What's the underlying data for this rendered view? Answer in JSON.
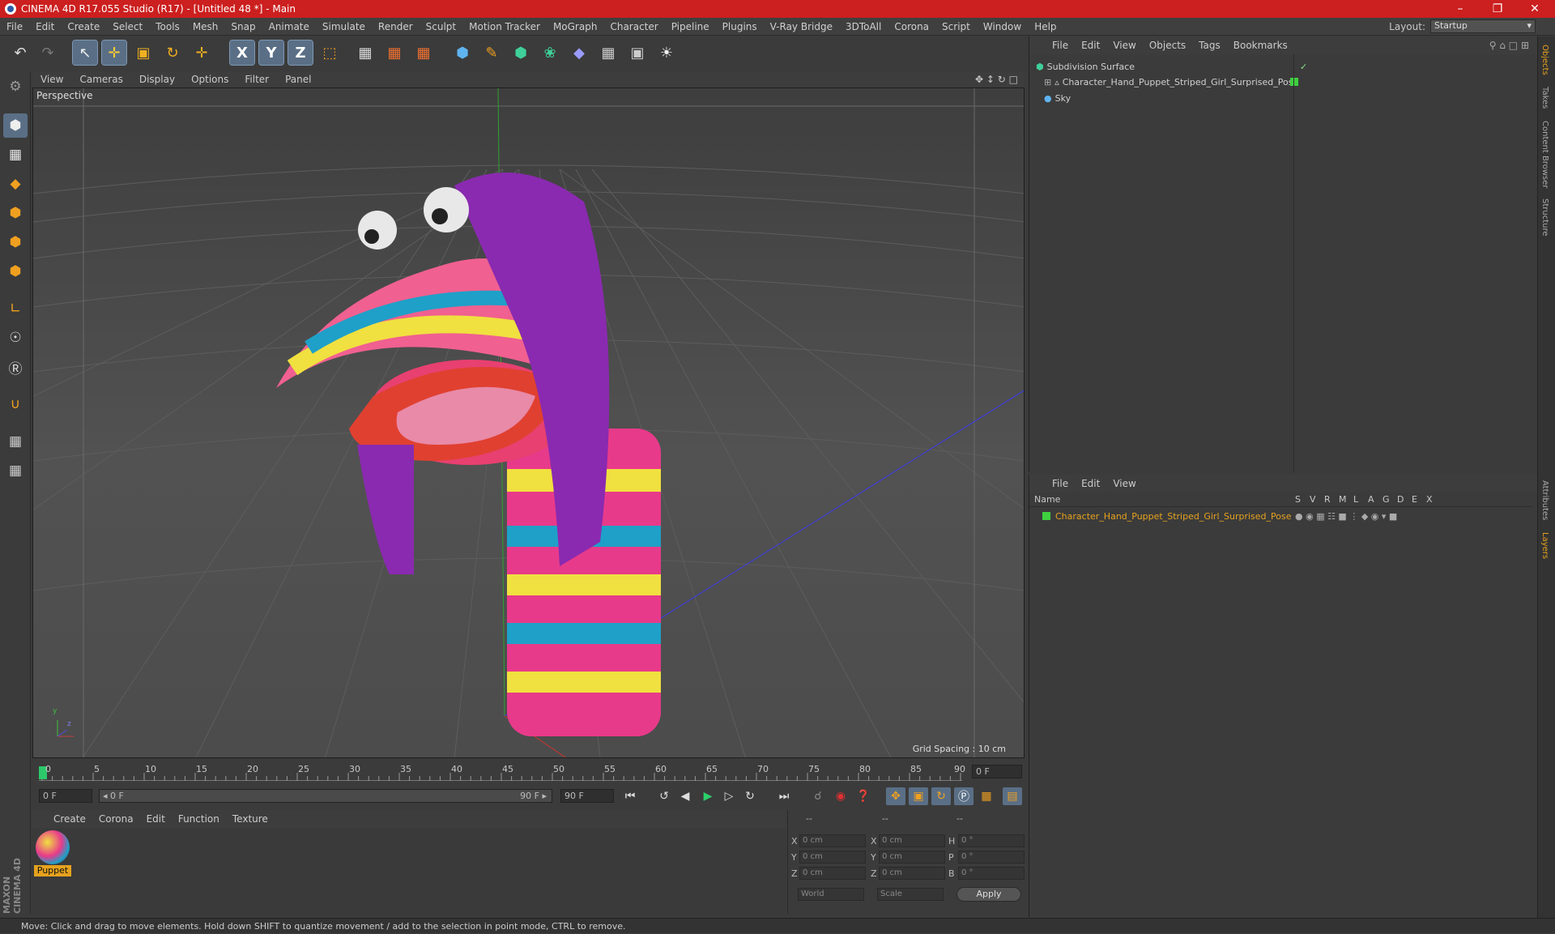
{
  "window": {
    "title": "CINEMA 4D R17.055 Studio (R17) - [Untitled 48 *] - Main",
    "controls": [
      "–",
      "❐",
      "✕"
    ]
  },
  "menubar": [
    "File",
    "Edit",
    "Create",
    "Select",
    "Tools",
    "Mesh",
    "Snap",
    "Animate",
    "Simulate",
    "Render",
    "Sculpt",
    "Motion Tracker",
    "MoGraph",
    "Character",
    "Pipeline",
    "Plugins",
    "V-Ray Bridge",
    "3DToAll",
    "Corona",
    "Script",
    "Window",
    "Help"
  ],
  "layout": {
    "label": "Layout:",
    "value": "Startup"
  },
  "toolbar": {
    "undo": "↶",
    "redo": "↷",
    "select": "↖",
    "move": "✛",
    "scale": "▣",
    "rotate": "↻",
    "transform": "✛",
    "x": "X",
    "y": "Y",
    "z": "Z",
    "coord": "⬚",
    "render1": "▦",
    "render2": "▦",
    "render3": "▦",
    "cube": "⬢",
    "pen": "✎",
    "subdiv": "⬢",
    "array": "❀",
    "deformer": "◆",
    "floor": "▦",
    "camera": "▣",
    "light": "☀"
  },
  "viewport": {
    "menu": [
      "View",
      "Cameras",
      "Display",
      "Options",
      "Filter",
      "Panel"
    ],
    "label": "Perspective",
    "grid_spacing": "Grid Spacing : 10 cm",
    "axis_y": "y",
    "axis_z": "z"
  },
  "timeline": {
    "ticks": [
      "0",
      "5",
      "10",
      "15",
      "20",
      "25",
      "30",
      "35",
      "40",
      "45",
      "50",
      "55",
      "60",
      "65",
      "70",
      "75",
      "80",
      "85",
      "90"
    ],
    "frame_end_field": "0 F"
  },
  "transport": {
    "start": "0 F",
    "range_start": "◂ 0 F",
    "range_end": "90 F ▸",
    "end": "90 F"
  },
  "materials": {
    "menu": [
      "Create",
      "Corona",
      "Edit",
      "Function",
      "Texture"
    ],
    "items": [
      {
        "name": "Puppet"
      }
    ]
  },
  "coords": {
    "header": [
      "--",
      "--",
      "--"
    ],
    "rows": [
      {
        "a": "X",
        "av": "0 cm",
        "b": "X",
        "bv": "0 cm",
        "c": "H",
        "cv": "0 °"
      },
      {
        "a": "Y",
        "av": "0 cm",
        "b": "Y",
        "bv": "0 cm",
        "c": "P",
        "cv": "0 °"
      },
      {
        "a": "Z",
        "av": "0 cm",
        "b": "Z",
        "bv": "0 cm",
        "c": "B",
        "cv": "0 °"
      }
    ],
    "mode1": "World",
    "mode2": "Scale",
    "apply": "Apply"
  },
  "objects": {
    "menu": [
      "File",
      "Edit",
      "View",
      "Objects",
      "Tags",
      "Bookmarks"
    ],
    "items": [
      {
        "name": "Subdivision Surface",
        "color": "#d0d0d0"
      },
      {
        "name": "Character_Hand_Puppet_Striped_Girl_Surprised_Pose",
        "color": "#d0d0d0"
      },
      {
        "name": "Sky",
        "color": "#d0d0d0"
      }
    ]
  },
  "layers": {
    "menu": [
      "File",
      "Edit",
      "View"
    ],
    "columns": [
      "Name",
      "S",
      "V",
      "R",
      "M",
      "L",
      "A",
      "G",
      "D",
      "E",
      "X"
    ],
    "items": [
      {
        "name": "Character_Hand_Puppet_Striped_Girl_Surprised_Pose",
        "color": "#e6a21e"
      }
    ]
  },
  "right_tabs": [
    "Objects",
    "Takes",
    "Content Browser",
    "Structure",
    "Attributes",
    "Layers"
  ],
  "status": "Move: Click and drag to move elements. Hold down SHIFT to quantize movement / add to the selection in point mode, CTRL to remove.",
  "brand": "MAXON CINEMA 4D"
}
